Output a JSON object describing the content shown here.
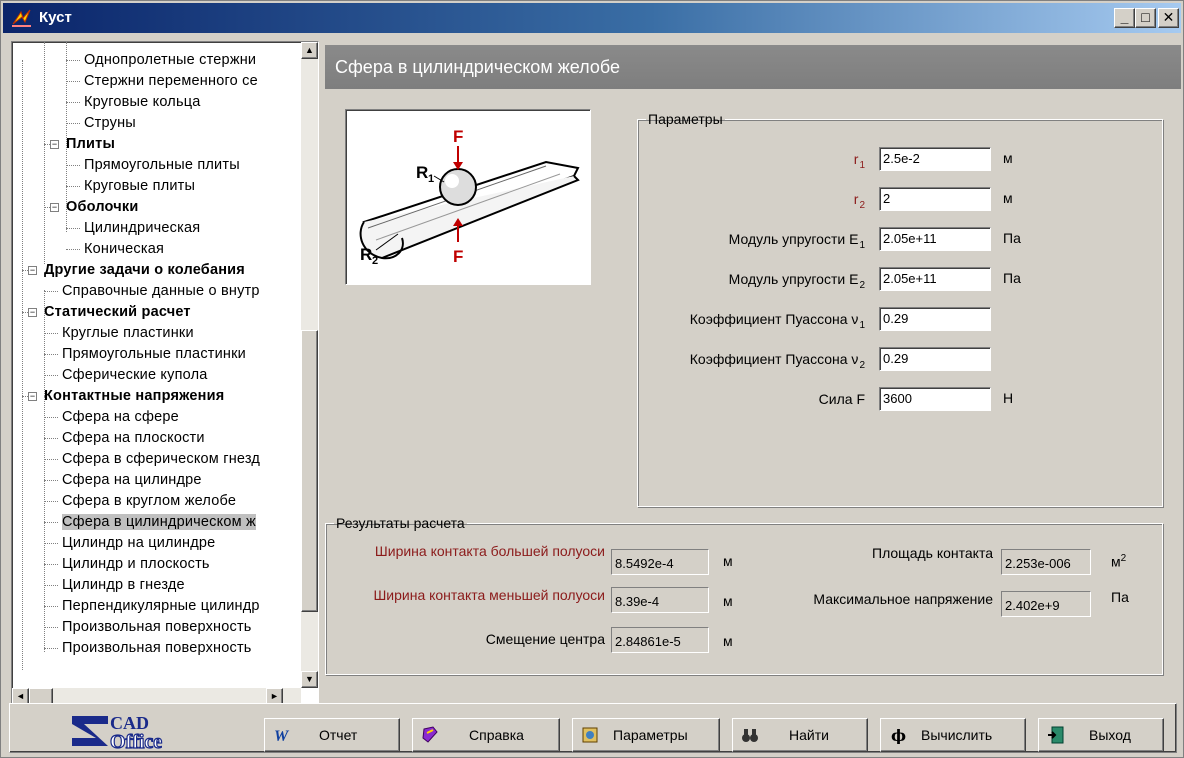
{
  "window": {
    "title": "Куст"
  },
  "tree": {
    "items": [
      {
        "label": "Однопролетные стержни",
        "bold": false
      },
      {
        "label": "Стержни переменного се",
        "bold": false
      },
      {
        "label": "Круговые кольца",
        "bold": false
      },
      {
        "label": "Струны",
        "bold": false
      },
      {
        "label": "Плиты",
        "bold": true
      },
      {
        "label": "Прямоугольные плиты",
        "bold": false
      },
      {
        "label": "Круговые плиты",
        "bold": false
      },
      {
        "label": "Оболочки",
        "bold": true
      },
      {
        "label": "Цилиндрическая",
        "bold": false
      },
      {
        "label": "Коническая",
        "bold": false
      },
      {
        "label": "Другие задачи о колебания",
        "bold": true
      },
      {
        "label": "Справочные данные о внутр",
        "bold": false
      },
      {
        "label": "Статический расчет",
        "bold": true
      },
      {
        "label": "Круглые пластинки",
        "bold": false
      },
      {
        "label": "Прямоугольные пластинки",
        "bold": false
      },
      {
        "label": "Сферические купола",
        "bold": false
      },
      {
        "label": "Контактные напряжения",
        "bold": true
      },
      {
        "label": "Сфера на сфере",
        "bold": false
      },
      {
        "label": "Сфера на плоскости",
        "bold": false
      },
      {
        "label": "Сфера в сферическом гнезд",
        "bold": false
      },
      {
        "label": "Сфера на цилиндре",
        "bold": false
      },
      {
        "label": "Сфера в круглом желобе",
        "bold": false
      },
      {
        "label": "Сфера в цилиндрическом ж",
        "bold": false,
        "selected": true
      },
      {
        "label": "Цилиндр на цилиндре",
        "bold": false
      },
      {
        "label": "Цилиндр и плоскость",
        "bold": false
      },
      {
        "label": "Цилиндр в гнезде",
        "bold": false
      },
      {
        "label": "Перпендикулярные цилиндр",
        "bold": false
      },
      {
        "label": "Произвольная поверхность",
        "bold": false
      },
      {
        "label": "Произвольная поверхность",
        "bold": false
      }
    ],
    "expander_symbol": "−"
  },
  "heading": "Сфера в цилиндрическом желобе",
  "figure": {
    "force": "F",
    "r1": "R",
    "r1_sub": "1",
    "r2": "R",
    "r2_sub": "2"
  },
  "params": {
    "legend": "Параметры",
    "rows": [
      {
        "label": "r",
        "sub": "1",
        "value": "2.5e-2",
        "unit": "м"
      },
      {
        "label": "r",
        "sub": "2",
        "value": "2",
        "unit": "м"
      },
      {
        "label": "Модуль упругости E",
        "sub": "1",
        "value": "2.05e+11",
        "unit": "Па"
      },
      {
        "label": "Модуль упругости E",
        "sub": "2",
        "value": "2.05e+11",
        "unit": "Па"
      },
      {
        "label": "Коэффициент Пуассона ν",
        "sub": "1",
        "value": "0.29",
        "unit": ""
      },
      {
        "label": "Коэффициент Пуассона ν",
        "sub": "2",
        "value": "0.29",
        "unit": ""
      },
      {
        "label": "Сила F",
        "sub": "",
        "value": "3600",
        "unit": "Н"
      }
    ]
  },
  "results": {
    "legend": "Результаты расчета",
    "major_width": {
      "label": "Ширина контакта большей полуоси",
      "value": "8.5492e-4",
      "unit": "м"
    },
    "minor_width": {
      "label": "Ширина контакта меньшей полуоси",
      "value": "8.39e-4",
      "unit": "м"
    },
    "center_shift": {
      "label": "Смещение центра",
      "value": "2.84861e-5",
      "unit": "м"
    },
    "contact_area": {
      "label": "Площадь контакта",
      "value": "2.253e-006",
      "unit": "м",
      "unit_sup": "2"
    },
    "max_stress": {
      "label": "Максимальное напряжение",
      "value": "2.402e+9",
      "unit": "Па"
    }
  },
  "logo": {
    "top": "CAD",
    "bottom": "Office",
    "letter": "S"
  },
  "toolbar": {
    "report": "Отчет",
    "help": "Справка",
    "params": "Параметры",
    "find": "Найти",
    "calc": "Вычислить",
    "exit": "Выход"
  },
  "colors": {
    "title_start": "#0a246a",
    "title_end": "#a6caf0",
    "label_red": "#8b1a1a",
    "heading_bg": "#808080"
  },
  "scrollbar_glyphs": {
    "up": "▲",
    "down": "▼",
    "left": "◄",
    "right": "►"
  },
  "window_buttons": {
    "minimize": "_",
    "maximize": "□",
    "close": "✕"
  }
}
